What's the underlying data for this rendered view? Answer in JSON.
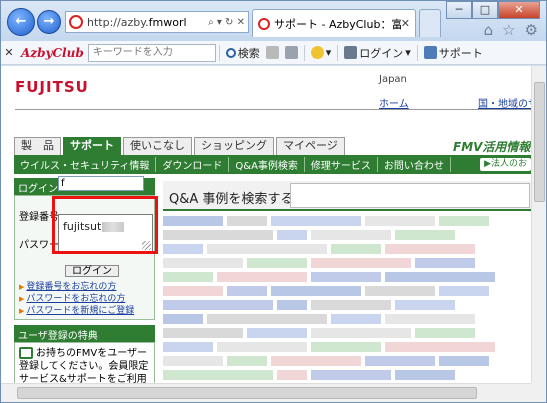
{
  "browser": {
    "back_label": "←",
    "forward_label": "→",
    "address_prefix": "http://azby.",
    "address_domain": "fmworl...",
    "address_icons": "⌕ ▾ ↻ ✕",
    "active_tab_title": "サポート - AzbyClub：富...",
    "tab_close": "✕",
    "window_controls": [
      "─",
      "□",
      "✕"
    ],
    "top_icons": [
      "⌂",
      "☆",
      "⚙"
    ]
  },
  "toolbar": {
    "close": "✕",
    "logo": "AzbyClub",
    "keyword_placeholder": "キーワードを入力",
    "search_label": "検索",
    "login_label": "ログイン",
    "support_label": "サポート"
  },
  "page": {
    "brand": "FUJITSU",
    "country": "Japan",
    "home_link": "ホーム",
    "region_link": "国・地域のサ",
    "nav_tabs": [
      "製　品",
      "サポート",
      "使いこなし",
      "ショッピング",
      "マイページ"
    ],
    "fmv_title": "FMV活用情報",
    "green_menu": [
      "ウイルス・セキュリティ情報",
      "ダウンロード",
      "Q&A事例検索",
      "修理サービス",
      "お問い合わせ"
    ],
    "corporate_link": "▶法人のお"
  },
  "sidebar": {
    "login_heading": "ログイン",
    "id_label": "登録番号",
    "password_label": "パスワード",
    "id_value": "f",
    "suggestion": "fujitsut",
    "login_button": "ログイン",
    "links": [
      "登録番号をお忘れの方",
      "パスワードをお忘れの方",
      "パスワードを新規にご登録"
    ],
    "benefit_heading": "ユーザ登録の特典",
    "benefit_text": "お持ちのFMVをユーザー登録してください。会員限定サービス&サポートをご利用いただけます"
  },
  "main": {
    "qa_heading": "Q&A 事例を検索する"
  }
}
